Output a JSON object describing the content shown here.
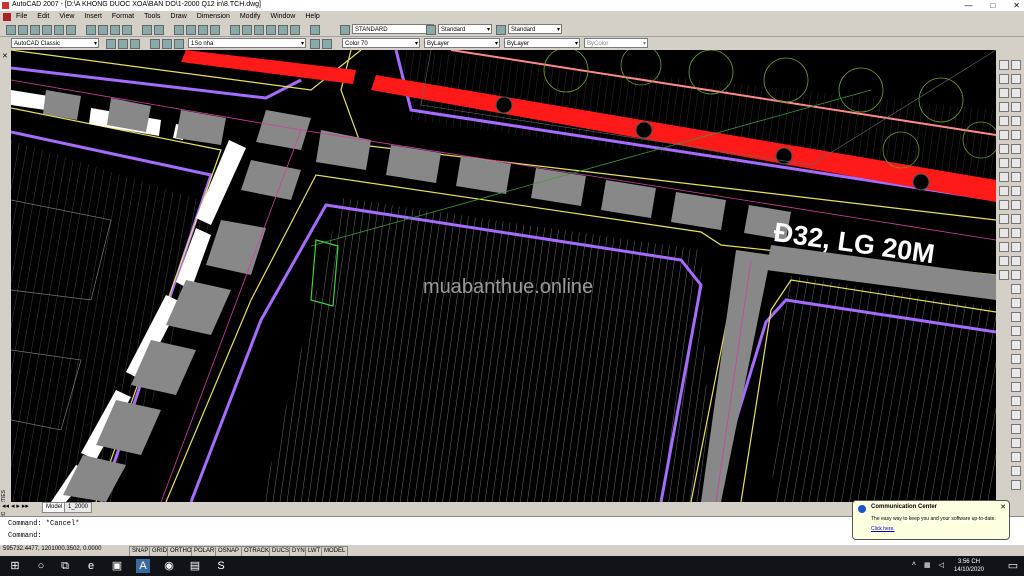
{
  "window": {
    "title": "AutoCAD 2007 - [D:\\A KHONG DUOC XOA\\BAN DO\\1-2000 Q12 in\\8.TCH.dwg]",
    "min": "—",
    "max": "□",
    "close": "✕"
  },
  "menu": [
    "File",
    "Edit",
    "View",
    "Insert",
    "Format",
    "Tools",
    "Draw",
    "Dimension",
    "Modify",
    "Window",
    "Help"
  ],
  "toolbar1": {
    "text_style": "STANDARD",
    "dim_style": "Standard",
    "table_style": "Standard"
  },
  "toolbar2": {
    "workspace": "AutoCAD Classic",
    "layer": "1So nha",
    "color": "Color 70",
    "linetype": "ByLayer",
    "lineweight": "ByLayer",
    "plotstyle": "ByColor"
  },
  "canvas": {
    "watermark": "muabanthue.online",
    "street_label": "Đ32, LG 20M"
  },
  "sidebar": {
    "close": "✕",
    "properties": "PROPERTIES"
  },
  "layout_tabs": [
    "Model",
    "1_2000"
  ],
  "command": {
    "line1": "Command: *Cancel*",
    "line2": "Command:"
  },
  "status": {
    "coords": "595732.4477, 1201000.3502, 0.0000",
    "buttons": [
      "SNAP",
      "GRID",
      "ORTHO",
      "POLAR",
      "OSNAP",
      "OTRACK",
      "DUCS",
      "DYN",
      "LWT",
      "MODEL"
    ]
  },
  "comm_center": {
    "title": "Communication Center",
    "message": "The easy way to keep you and your software up-to-date.",
    "link": "Click here.",
    "close": "✕"
  },
  "taskbar": {
    "time": "3:56 CH",
    "date": "14/10/2020"
  },
  "colors": {
    "background": "#000000",
    "road_red": "#ff1a1a",
    "purple": "#a66bff",
    "yellow": "#e8e05a",
    "building_gray": "#888888"
  }
}
